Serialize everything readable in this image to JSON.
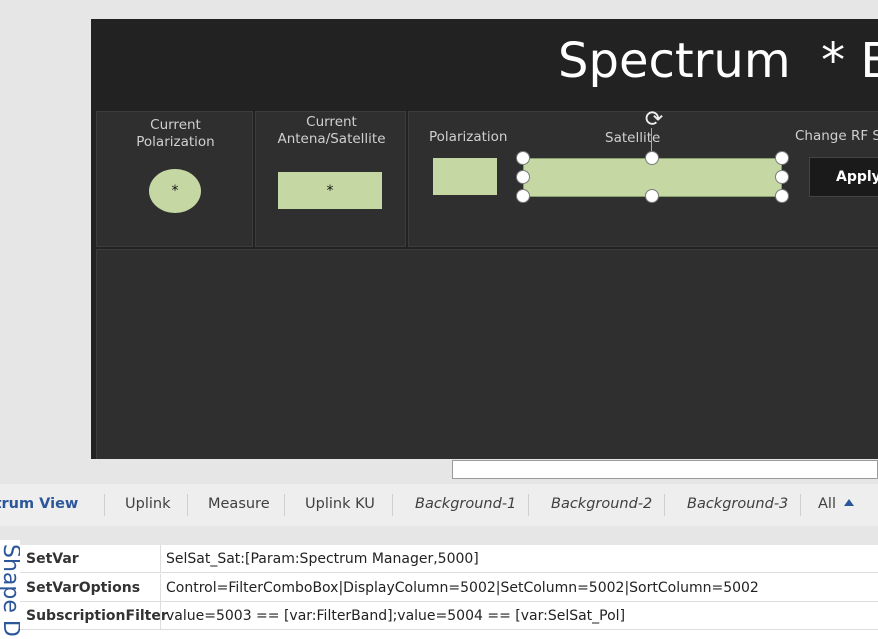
{
  "canvas": {
    "title": "Spectrum  * Bar",
    "panel1": {
      "label_line1": "Current",
      "label_line2": "Polarization",
      "value": "*"
    },
    "panel2": {
      "label_line1": "Current",
      "label_line2": "Antena/Satellite",
      "value": "*"
    },
    "panel3": {
      "polarization_label": "Polarization",
      "satellite_label": "Satellite",
      "change_label": "Change RF Sw",
      "apply_label": "Apply"
    }
  },
  "tabs": [
    {
      "label": "ctrum View"
    },
    {
      "label": "Uplink"
    },
    {
      "label": "Measure"
    },
    {
      "label": "Uplink KU"
    },
    {
      "label": "Background-1"
    },
    {
      "label": "Background-2"
    },
    {
      "label": "Background-3"
    },
    {
      "label": "All"
    }
  ],
  "side_panel": {
    "title": "Shape D"
  },
  "properties": [
    {
      "name": "SetVar",
      "value": "SelSat_Sat:[Param:Spectrum Manager,5000]"
    },
    {
      "name": "SetVarOptions",
      "value": "Control=FilterComboBox|DisplayColumn=5002|SetColumn=5002|SortColumn=5002"
    },
    {
      "name": "SubscriptionFilter",
      "value": "value=5003 == [var:FilterBand];value=5004 == [var:SelSat_Pol]"
    }
  ],
  "colors": {
    "shape_fill": "#c5d8a4",
    "canvas_bg": "#222222",
    "accent": "#2b579a"
  }
}
